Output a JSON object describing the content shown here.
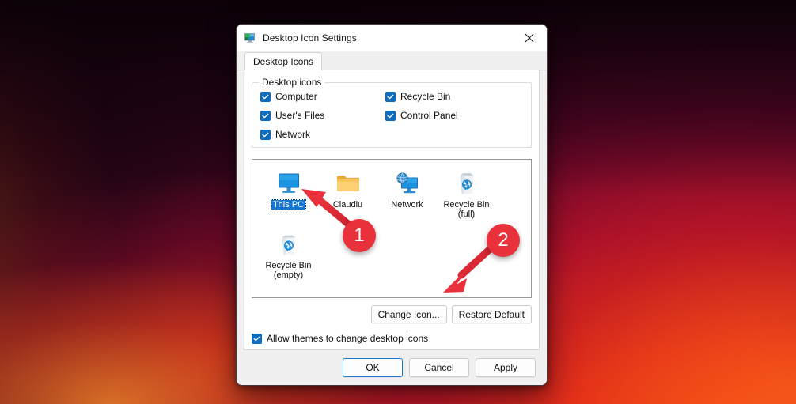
{
  "wallpaper": {
    "name": "windows-11-bloom-red",
    "colors": [
      "#1b0312",
      "#5c0628",
      "#a80f2c",
      "#e4301a",
      "#ff7a1a"
    ]
  },
  "dialog": {
    "title": "Desktop Icon Settings",
    "title_icon": "monitor-icon",
    "close_icon": "close-icon",
    "tabs": [
      {
        "label": "Desktop Icons",
        "selected": true
      }
    ],
    "groupbox": {
      "title": "Desktop icons",
      "checkboxes": [
        {
          "label": "Computer",
          "checked": true
        },
        {
          "label": "Recycle Bin",
          "checked": true
        },
        {
          "label": "User's Files",
          "checked": true
        },
        {
          "label": "Control Panel",
          "checked": true
        },
        {
          "label": "Network",
          "checked": true
        }
      ]
    },
    "preview": {
      "icons": [
        {
          "label": "This PC",
          "label_line2": "",
          "icon": "computer-monitor-icon",
          "selected": true
        },
        {
          "label": "Claudiu",
          "label_line2": "",
          "icon": "folder-icon",
          "selected": false
        },
        {
          "label": "Network",
          "label_line2": "",
          "icon": "network-globe-icon",
          "selected": false
        },
        {
          "label": "Recycle Bin",
          "label_line2": "(full)",
          "icon": "recycle-bin-full-icon",
          "selected": false
        },
        {
          "label": "Recycle Bin",
          "label_line2": "(empty)",
          "icon": "recycle-bin-empty-icon",
          "selected": false
        }
      ]
    },
    "action_buttons": [
      {
        "label": "Change Icon..."
      },
      {
        "label": "Restore Default"
      }
    ],
    "allow_themes": {
      "label": "Allow themes to change desktop icons",
      "checked": true
    },
    "footer_buttons": [
      {
        "label": "OK",
        "default": true
      },
      {
        "label": "Cancel",
        "default": false
      },
      {
        "label": "Apply",
        "default": false
      }
    ]
  },
  "annotations": {
    "accent_color": "#e8313a",
    "markers": [
      {
        "number": "1",
        "points_to": "this-pc-icon-label"
      },
      {
        "number": "2",
        "points_to": "change-icon-button"
      }
    ]
  }
}
